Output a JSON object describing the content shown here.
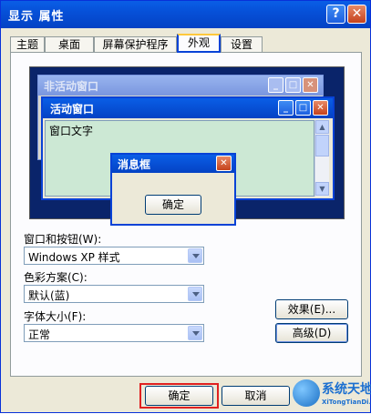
{
  "window": {
    "title": "显示 属性",
    "help_glyph": "?",
    "close_glyph": "✕"
  },
  "tabs": [
    {
      "label": "主题",
      "active": false
    },
    {
      "label": "桌面",
      "active": false
    },
    {
      "label": "屏幕保护程序",
      "active": false
    },
    {
      "label": "外观",
      "active": true
    },
    {
      "label": "设置",
      "active": false
    }
  ],
  "preview": {
    "inactive_title": "非活动窗口",
    "active_title": "活动窗口",
    "window_text": "窗口文字",
    "message_box_title": "消息框",
    "message_ok": "确定",
    "minimize_glyph": "_",
    "maximize_glyph": "□",
    "close_glyph": "✕",
    "scroll_up_glyph": "▲",
    "scroll_down_glyph": "▼"
  },
  "appearance": {
    "windows_buttons_label": "窗口和按钮(W):",
    "windows_buttons_value": "Windows XP 样式",
    "color_scheme_label": "色彩方案(C):",
    "color_scheme_value": "默认(蓝)",
    "font_size_label": "字体大小(F):",
    "font_size_value": "正常",
    "effects_button": "效果(E)...",
    "advanced_button": "高级(D)"
  },
  "footer": {
    "ok_button": "确定",
    "cancel_button": "取消"
  },
  "watermark": {
    "name": "系统天地",
    "url": "XiTongTianDi.net"
  },
  "colors": {
    "titlebar": "#0650d8",
    "dialog_bg": "#ece9d8",
    "preview_desktop": "#0a246a",
    "window_body": "#cce8d4",
    "highlight_box": "#e02020"
  }
}
